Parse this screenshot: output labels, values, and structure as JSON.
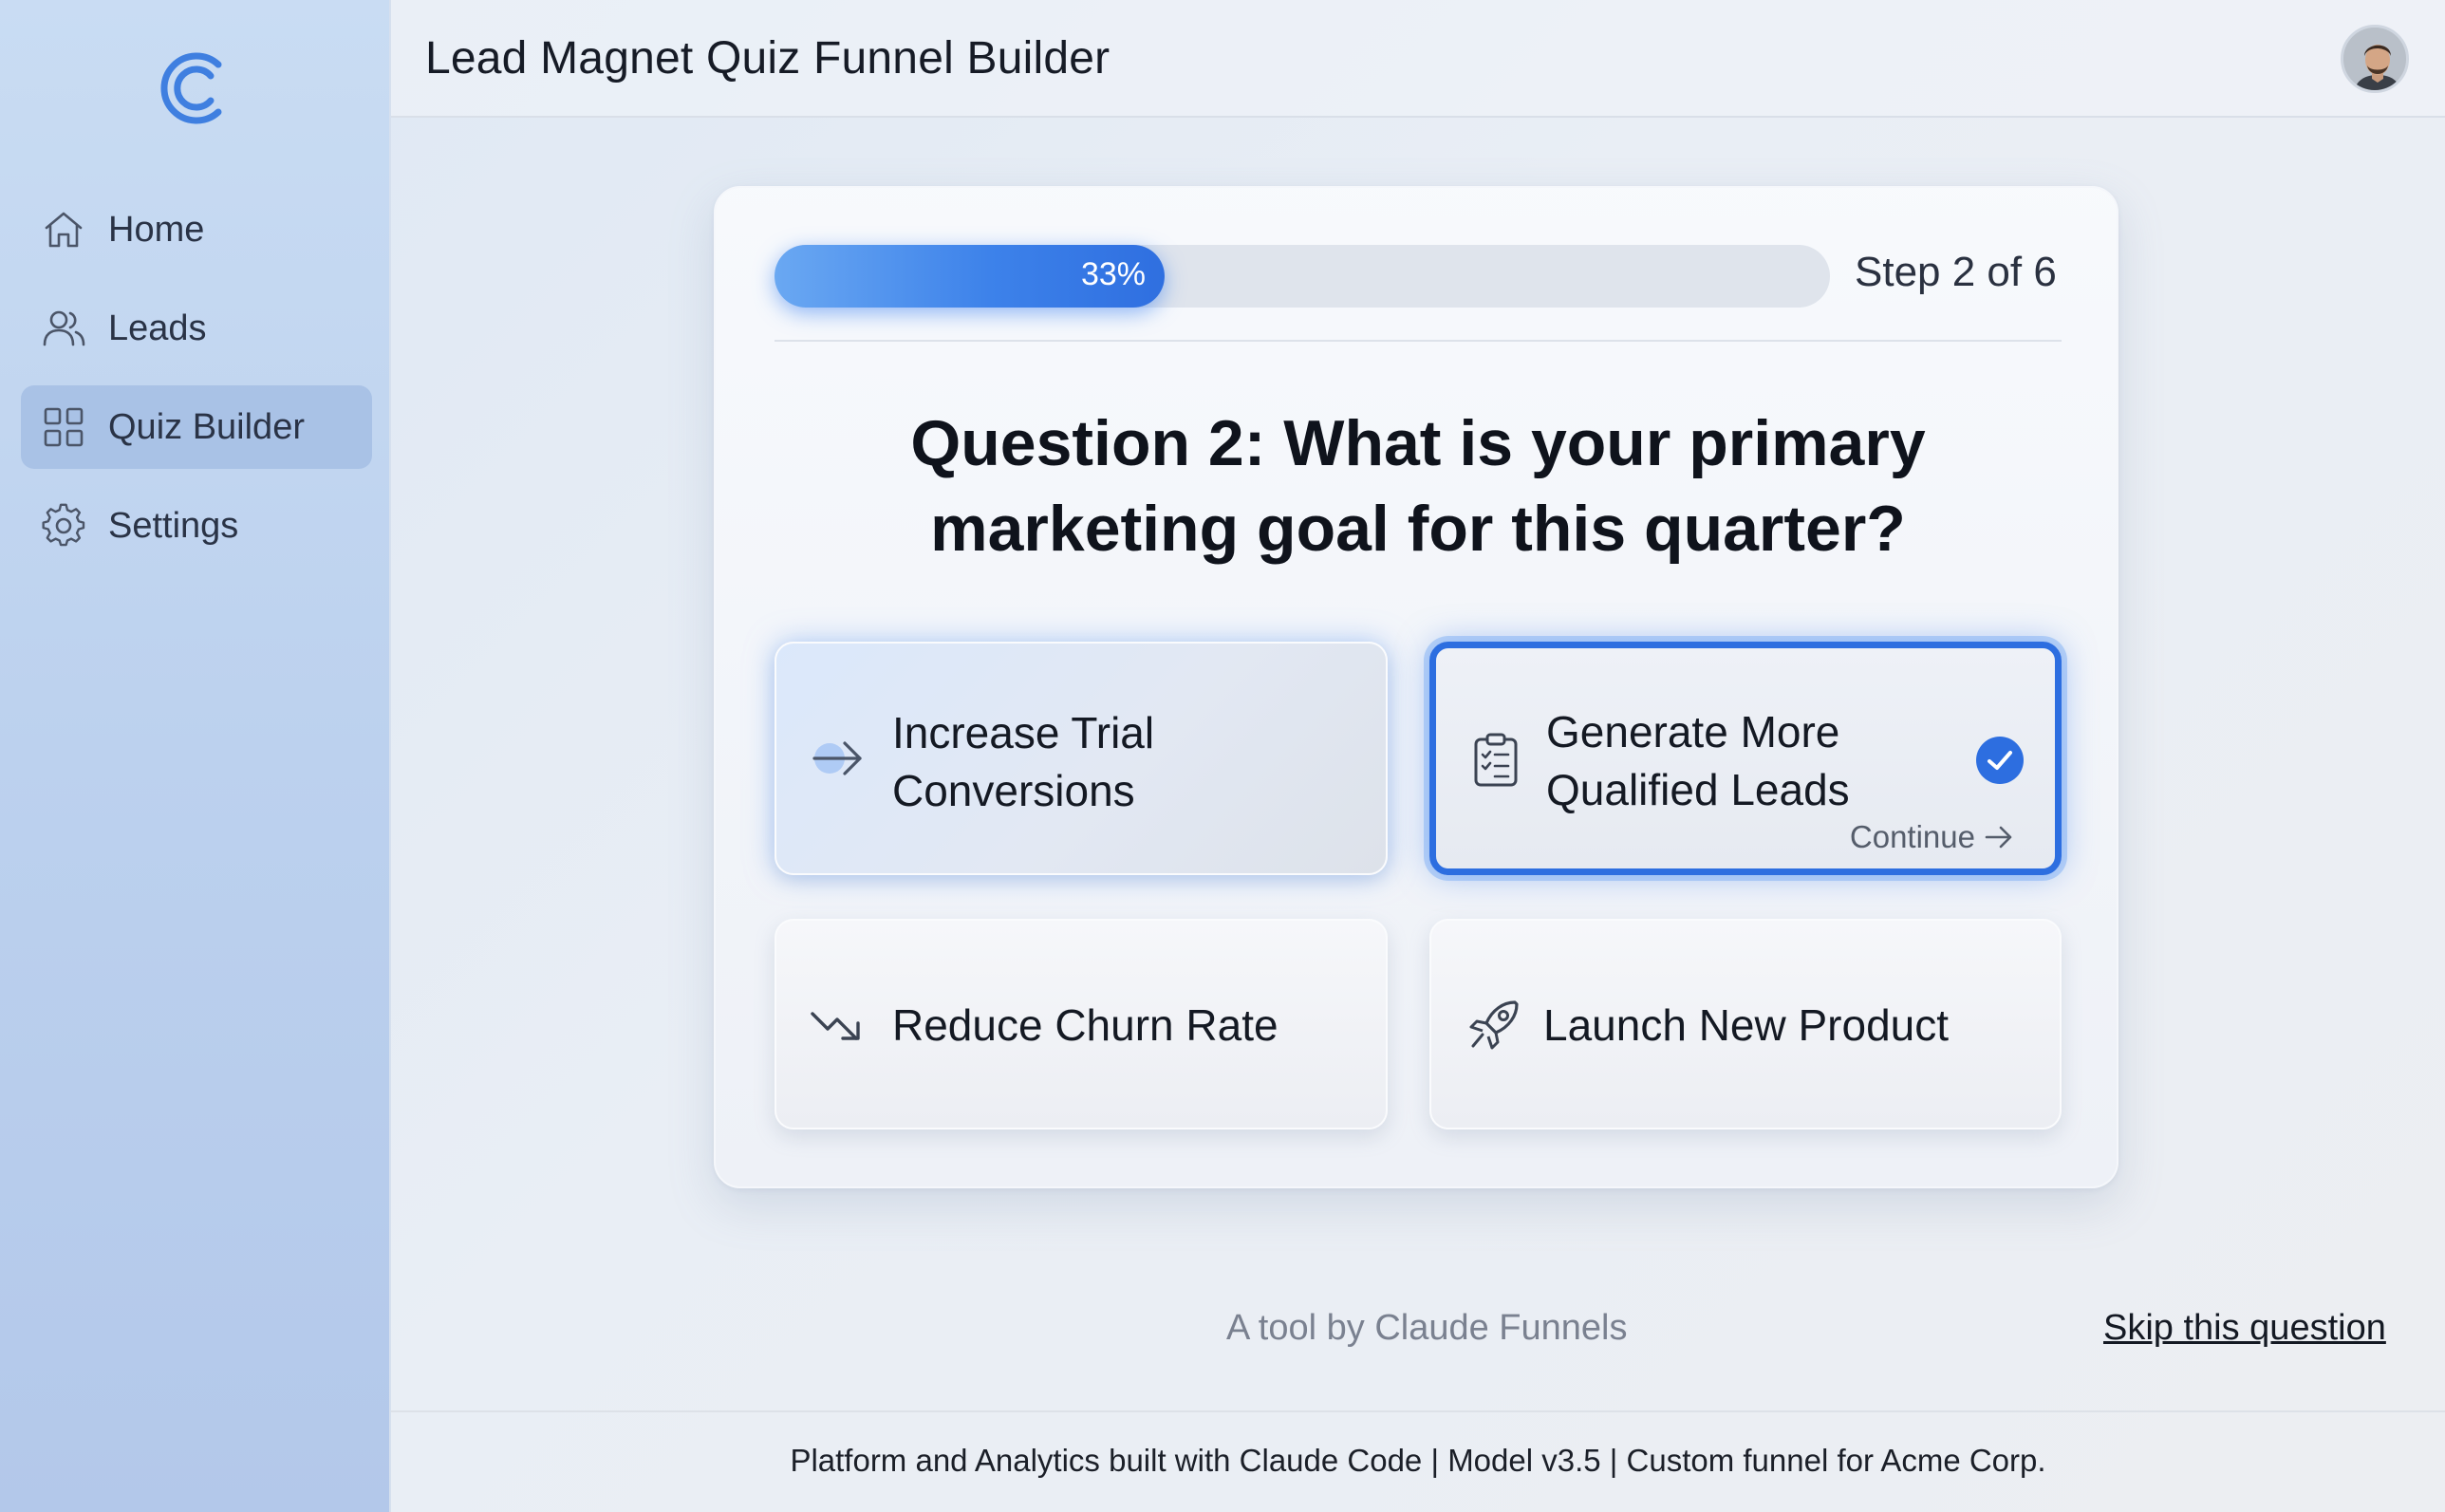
{
  "app": {
    "title": "Lead Magnet Quiz Funnel Builder"
  },
  "sidebar": {
    "items": [
      {
        "label": "Home",
        "icon": "home-icon",
        "active": false
      },
      {
        "label": "Leads",
        "icon": "users-icon",
        "active": false
      },
      {
        "label": "Quiz Builder",
        "icon": "grid-icon",
        "active": true
      },
      {
        "label": "Settings",
        "icon": "gear-icon",
        "active": false
      }
    ]
  },
  "quiz": {
    "progress_label": "33%",
    "progress_value": 0.33,
    "step_label": "Step 2 of 6",
    "question": "Question 2: What is your primary marketing goal for this quarter?",
    "options": [
      {
        "label_line1": "Increase Trial",
        "label_line2": "Conversions",
        "icon": "arrow-right-icon",
        "selected": false
      },
      {
        "label_line1": "Generate More",
        "label_line2": "Qualified Leads",
        "icon": "clipboard-checklist-icon",
        "selected": true,
        "continue_label": "Continue"
      },
      {
        "label": "Reduce Churn Rate",
        "icon": "trend-down-icon",
        "selected": false
      },
      {
        "label": "Launch New Product",
        "icon": "rocket-icon",
        "selected": false
      }
    ]
  },
  "credit": "A tool by Claude Funnels",
  "skip_label": "Skip this question",
  "footer": "Platform and Analytics built with Claude Code | Model v3.5 | Custom funnel for Acme Corp.",
  "colors": {
    "accent": "#2d6ee0",
    "progress": "#3d82ea",
    "sidebar": "#bcd1ee"
  }
}
